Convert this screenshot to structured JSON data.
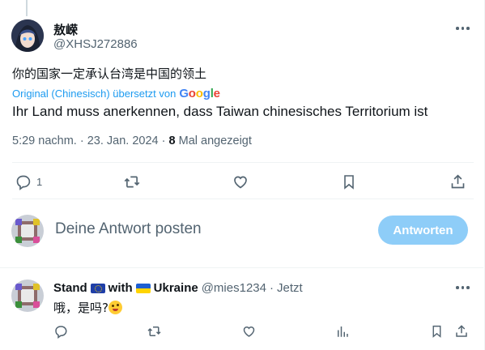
{
  "tweet": {
    "author_name": "敖嵘",
    "author_handle": "@XHSJ272886",
    "text": "你的国家一定承认台湾是中国的领土",
    "translation_note": "Original (Chinesisch) übersetzt von",
    "translation_provider": "Google",
    "translated_text": "Ihr Land muss anerkennen, dass Taiwan chinesisches Territorium ist",
    "time": "5:29 nachm.",
    "separator": "·",
    "date": "23. Jan. 2024",
    "views_count": "8",
    "views_label": "Mal angezeigt",
    "reply_count": "1",
    "icons": [
      "reply-icon",
      "retweet-icon",
      "like-icon",
      "bookmark-icon",
      "share-icon",
      "more-icon"
    ]
  },
  "composer": {
    "placeholder": "Deine Antwort posten",
    "submit_label": "Antworten"
  },
  "reply": {
    "name_part1": "Stand",
    "name_part2": "with",
    "name_part3": "Ukraine",
    "handle": "@mies1234",
    "separator": "·",
    "time": "Jetzt",
    "text": "哦，是吗?",
    "icons": [
      "reply-icon",
      "retweet-icon",
      "like-icon",
      "views-icon",
      "bookmark-icon",
      "share-icon",
      "more-icon"
    ]
  },
  "colors": {
    "accent": "#1d9bf0",
    "button_disabled": "#8ecdf8",
    "secondary_text": "#536471",
    "primary_text": "#0f1419"
  }
}
